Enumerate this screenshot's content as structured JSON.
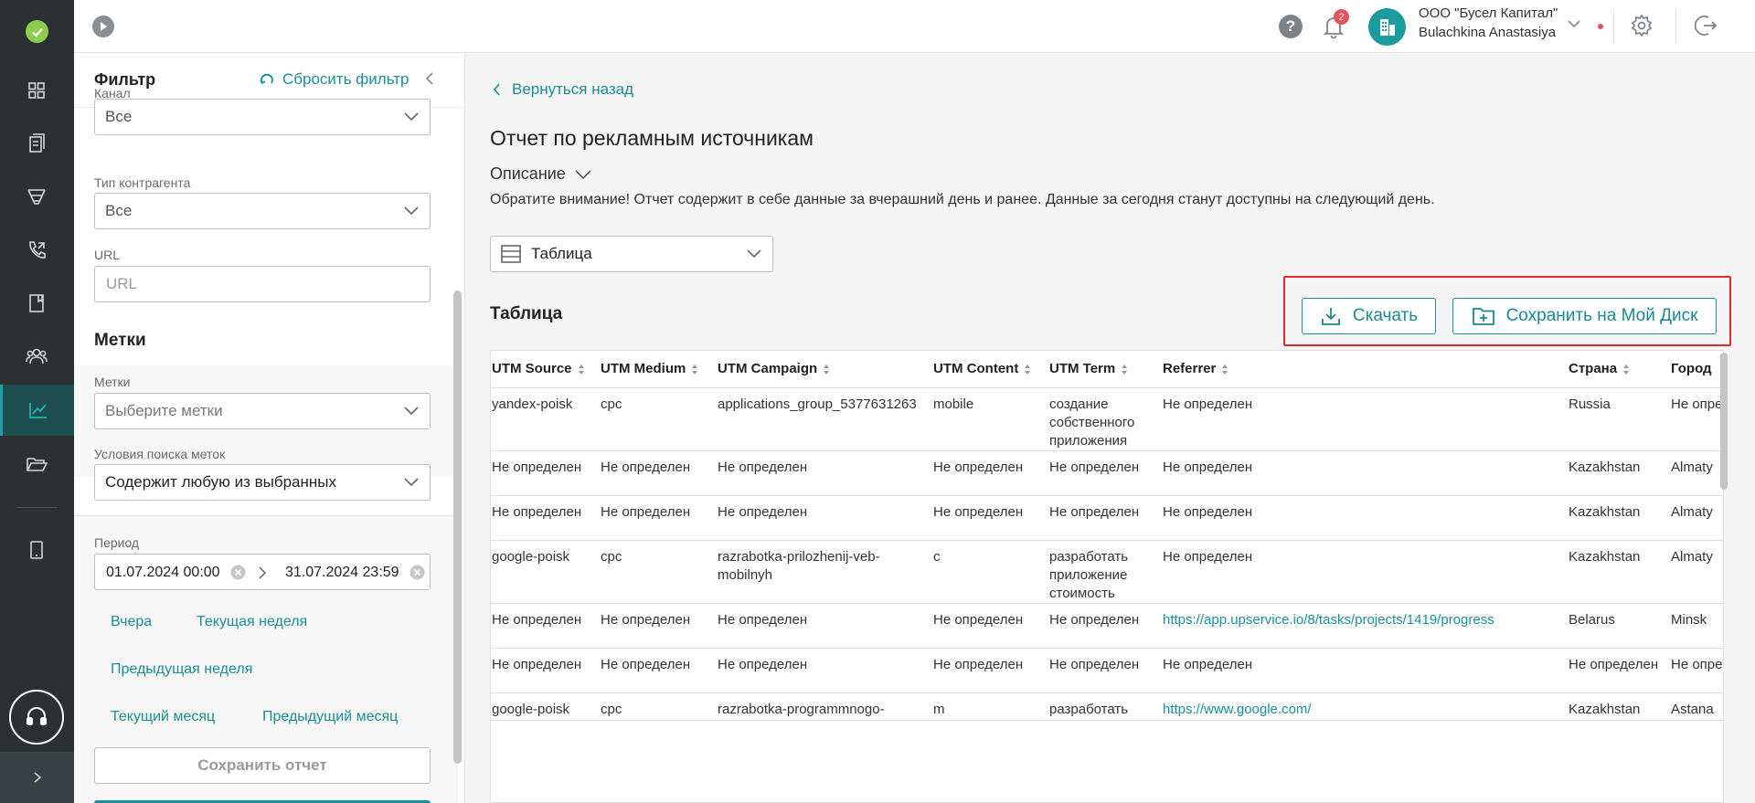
{
  "colors": {
    "accent": "#1a9096",
    "rail": "#2c3033",
    "highlight": "#e02b2b",
    "badge": "#e8505b"
  },
  "rail": {
    "icons": [
      "check-logo-icon",
      "dashboard-icon",
      "documents-icon",
      "funnel-icon",
      "phone-icon",
      "book-icon",
      "users-icon",
      "analytics-icon",
      "folder-icon",
      "tablet-icon",
      "headset-icon",
      "chevron-right-icon"
    ]
  },
  "topbar": {
    "notifications_count": "2",
    "org_name": "ООО \"Бусел Капитал\"",
    "user_name": "Bulachkina Anastasiya"
  },
  "filter": {
    "title": "Фильтр",
    "reset_label": "Сбросить фильтр",
    "channel_label": "Канал",
    "channel_value": "Все",
    "contractor_label": "Тип контрагента",
    "contractor_value": "Все",
    "url_label": "URL",
    "url_placeholder": "URL",
    "tags_section": "Метки",
    "tags_label": "Метки",
    "tags_placeholder": "Выберите метки",
    "tag_condition_label": "Условия поиска меток",
    "tag_condition_value": "Содержит любую из выбранных",
    "period_label": "Период",
    "period_from": "01.07.2024 00:00",
    "period_to": "31.07.2024 23:59",
    "quick": {
      "yesterday": "Вчера",
      "this_week": "Текущая неделя",
      "last_week": "Предыдущая неделя",
      "this_month": "Текущий месяц",
      "last_month": "Предыдущий месяц"
    },
    "save_report": "Сохранить отчет"
  },
  "main": {
    "back": "Вернуться назад",
    "title": "Отчет по рекламным источникам",
    "description_toggle": "Описание",
    "notice": "Обратите внимание! Отчет содержит в себе данные за вчерашний день и ранее. Данные за сегодня станут доступны на следующий день.",
    "view_value": "Таблица",
    "table_title": "Таблица",
    "download": "Скачать",
    "save_to_disk": "Сохранить на Мой Диск"
  },
  "table": {
    "columns": [
      "UTM Source",
      "UTM Medium",
      "UTM Campaign",
      "UTM Content",
      "UTM Term",
      "Referrer",
      "Страна",
      "Город"
    ],
    "rows": [
      [
        "yandex-poisk",
        "cpc",
        "applications_group_5377631263",
        "mobile",
        "создание собственного приложения",
        "Не определен",
        "Russia",
        "Не опре"
      ],
      [
        "Не определен",
        "Не определен",
        "Не определен",
        "Не определен",
        "Не определен",
        "Не определен",
        "Kazakhstan",
        "Almaty"
      ],
      [
        "Не определен",
        "Не определен",
        "Не определен",
        "Не определен",
        "Не определен",
        "Не определен",
        "Kazakhstan",
        "Almaty"
      ],
      [
        "google-poisk",
        "cpc",
        "razrabotka-prilozhenij-veb-mobilnyh",
        "c",
        "разработать приложение стоимость",
        "Не определен",
        "Kazakhstan",
        "Almaty"
      ],
      [
        "Не определен",
        "Не определен",
        "Не определен",
        "Не определен",
        "Не определен",
        "https://app.upservice.io/8/tasks/projects/1419/progress",
        "Belarus",
        "Minsk"
      ],
      [
        "Не определен",
        "Не определен",
        "Не определен",
        "Не определен",
        "Не определен",
        "Не определен",
        "Не определен",
        "Не опре"
      ],
      [
        "google-poisk",
        "cpc",
        "razrabotka-programmnogo-",
        "m",
        "разработать",
        "https://www.google.com/",
        "Kazakhstan",
        "Astana"
      ]
    ]
  }
}
